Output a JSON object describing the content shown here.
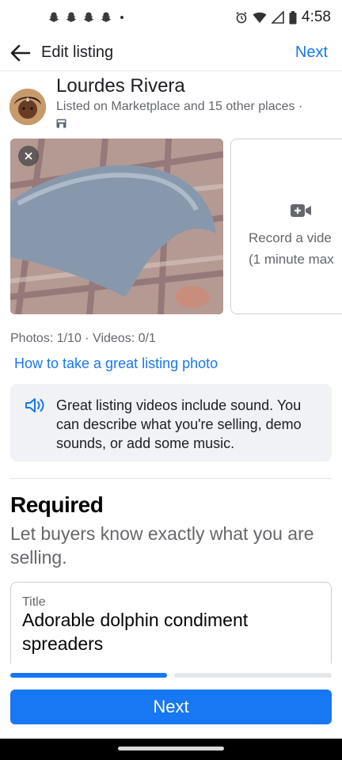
{
  "status_bar": {
    "time": "4:58"
  },
  "header": {
    "title": "Edit listing",
    "next_label": "Next"
  },
  "seller": {
    "name": "Lourdes Rivera",
    "listed_on": "Listed on Marketplace and 15 other places ·"
  },
  "media": {
    "record_video_line1": "Record a vide",
    "record_video_line2": "(1 minute max",
    "counts": "Photos: 1/10 · Videos: 0/1",
    "photo_tip_link": "How to take a great listing photo"
  },
  "info": {
    "text": "Great listing videos include sound. You can describe what you're selling, demo sounds, or add some music."
  },
  "required": {
    "title": "Required",
    "subtitle": "Let buyers know exactly what you are selling.",
    "title_field": {
      "label": "Title",
      "value": "Adorable dolphin condiment spreaders"
    }
  },
  "progress": {
    "completed_steps": 1,
    "total_steps": 2
  },
  "footer": {
    "next_label": "Next"
  },
  "colors": {
    "accent": "#1877f2",
    "secondary_text": "#65676b",
    "info_bg": "#f0f2f5"
  }
}
